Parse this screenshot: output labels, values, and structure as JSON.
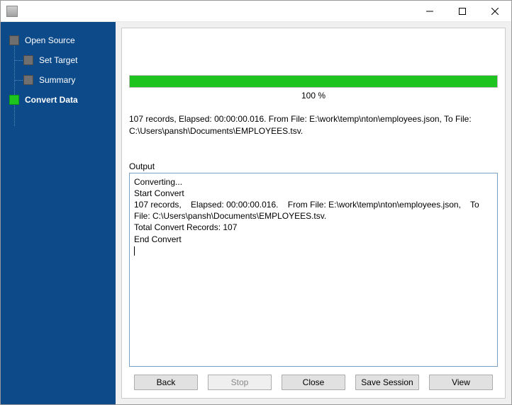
{
  "titlebar": {
    "title": ""
  },
  "sidebar": {
    "steps": [
      {
        "label": "Open Source"
      },
      {
        "label": "Set Target"
      },
      {
        "label": "Summary"
      },
      {
        "label": "Convert Data"
      }
    ]
  },
  "progress": {
    "percent_label": "100 %",
    "fill_percent": 100
  },
  "summary_text": "107 records,    Elapsed: 00:00:00.016.    From File: E:\\work\\temp\\nton\\employees.json,    To File: C:\\Users\\pansh\\Documents\\EMPLOYEES.tsv.",
  "output": {
    "label": "Output",
    "lines": [
      "Converting...",
      "Start Convert",
      "107 records,    Elapsed: 00:00:00.016.    From File: E:\\work\\temp\\nton\\employees.json,    To File: C:\\Users\\pansh\\Documents\\EMPLOYEES.tsv.",
      "Total Convert Records: 107",
      "End Convert"
    ]
  },
  "buttons": {
    "back": "Back",
    "stop": "Stop",
    "close": "Close",
    "save_session": "Save Session",
    "view": "View"
  }
}
